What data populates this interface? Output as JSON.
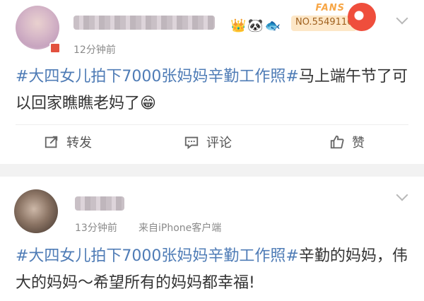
{
  "post1": {
    "time": "12分钟前",
    "fans_word": "FANS",
    "fans_no": "NO.5549110",
    "topic": "#大四女儿拍下7000张妈妈辛勤工作照#",
    "text": "马上端午节了可以回家瞧瞧老妈了",
    "emoji": "😁",
    "actions": {
      "repost": "转发",
      "comment": "评论",
      "like": "赞"
    }
  },
  "post2": {
    "time": "13分钟前",
    "source": "来自iPhone客户端",
    "topic": "#大四女儿拍下7000张妈妈辛勤工作照#",
    "text": "辛勤的妈妈，伟大的妈妈～希望所有的妈妈都幸福!"
  },
  "colors": {
    "topic": "#4f7cb6",
    "text": "#333333",
    "meta": "#8a8a8a"
  }
}
